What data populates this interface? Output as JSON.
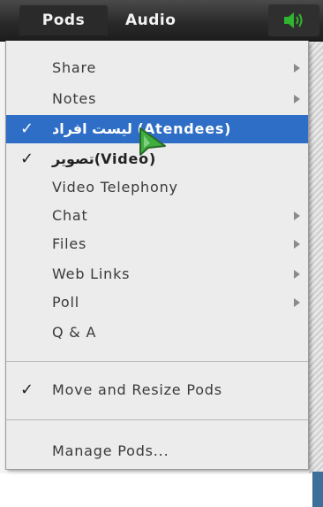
{
  "menubar": {
    "pods": "Pods",
    "audio": "Audio",
    "speaker_icon": "speaker-icon",
    "speaker_color": "#2fb52f"
  },
  "dropdown": {
    "share": "Share",
    "notes": "Notes",
    "attendees": "ليست افراد (Atendees)",
    "video": "تصویر(Video)",
    "video_telephony": "Video Telephony",
    "chat": "Chat",
    "files": "Files",
    "web_links": "Web Links",
    "poll": "Poll",
    "qa": "Q & A",
    "move_resize": "Move and Resize Pods",
    "manage_pods": "Manage Pods...",
    "check_glyph": "✓",
    "selected_color": "#2e6ec6"
  }
}
